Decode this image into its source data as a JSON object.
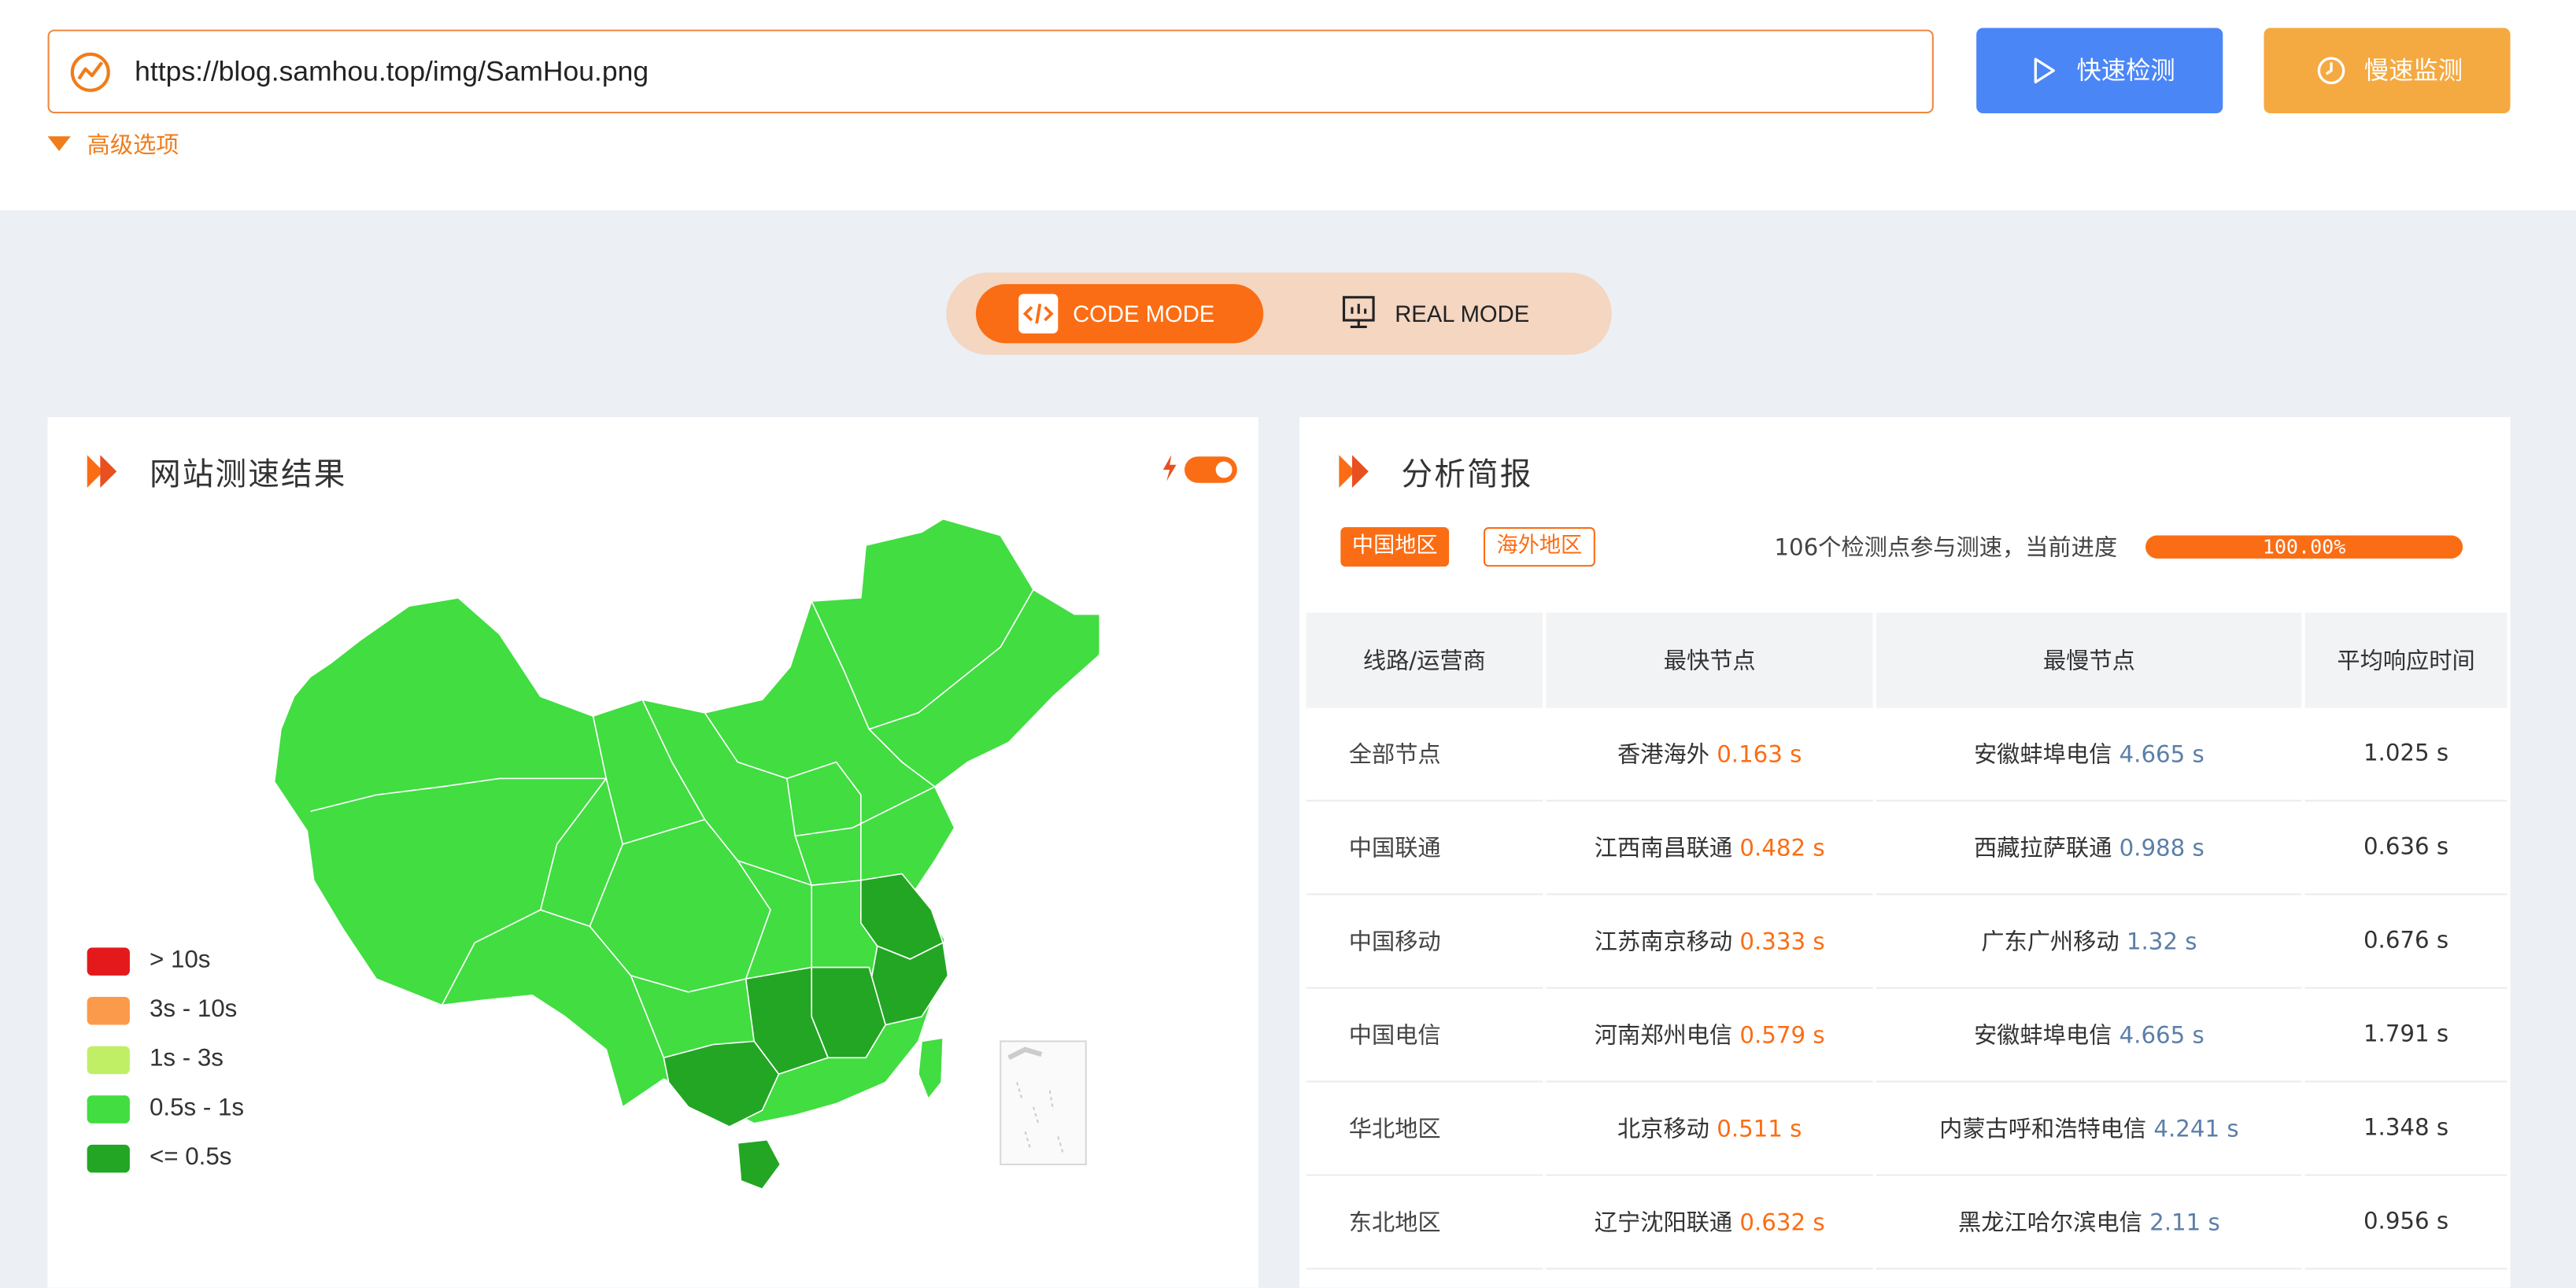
{
  "url_input": {
    "value": "https://blog.samhou.top/img/SamHou.png"
  },
  "buttons": {
    "quick": "快速检测",
    "slow": "慢速监测"
  },
  "advanced": "高级选项",
  "modes": {
    "code": "CODE MODE",
    "real": "REAL MODE"
  },
  "left_card": {
    "title": "网站测速结果",
    "legend": [
      {
        "label": "> 10s",
        "color": "#e3191c"
      },
      {
        "label": "3s - 10s",
        "color": "#fb9a4a"
      },
      {
        "label": "1s - 3s",
        "color": "#c0ef66"
      },
      {
        "label": "0.5s - 1s",
        "color": "#41dd41"
      },
      {
        "label": "<= 0.5s",
        "color": "#23a623"
      }
    ]
  },
  "right_card": {
    "title": "分析简报",
    "tabs": [
      "中国地区",
      "海外地区"
    ],
    "summary": "106个检测点参与测速，当前进度",
    "progress": {
      "value": 100.0,
      "label": "100.00%"
    },
    "headers": [
      "线路/运营商",
      "最快节点",
      "最慢节点",
      "平均响应时间"
    ],
    "rows": [
      {
        "name": "全部节点",
        "fast_node": "香港海外",
        "fast_time": "0.163 s",
        "slow_node": "安徽蚌埠电信",
        "slow_time": "4.665 s",
        "avg": "1.025 s"
      },
      {
        "name": "中国联通",
        "fast_node": "江西南昌联通",
        "fast_time": "0.482 s",
        "slow_node": "西藏拉萨联通",
        "slow_time": "0.988 s",
        "avg": "0.636 s"
      },
      {
        "name": "中国移动",
        "fast_node": "江苏南京移动",
        "fast_time": "0.333 s",
        "slow_node": "广东广州移动",
        "slow_time": "1.32 s",
        "avg": "0.676 s"
      },
      {
        "name": "中国电信",
        "fast_node": "河南郑州电信",
        "fast_time": "0.579 s",
        "slow_node": "安徽蚌埠电信",
        "slow_time": "4.665 s",
        "avg": "1.791 s"
      },
      {
        "name": "华北地区",
        "fast_node": "北京移动",
        "fast_time": "0.511 s",
        "slow_node": "内蒙古呼和浩特电信",
        "slow_time": "4.241 s",
        "avg": "1.348 s"
      },
      {
        "name": "东北地区",
        "fast_node": "辽宁沈阳联通",
        "fast_time": "0.632 s",
        "slow_node": "黑龙江哈尔滨电信",
        "slow_time": "2.11 s",
        "avg": "0.956 s"
      }
    ]
  },
  "colors": {
    "accent": "#fb6d14",
    "quick_btn": "#4b86f7",
    "slow_btn": "#f5a941",
    "map_mid": "#41dd41",
    "map_fast": "#23a623"
  }
}
